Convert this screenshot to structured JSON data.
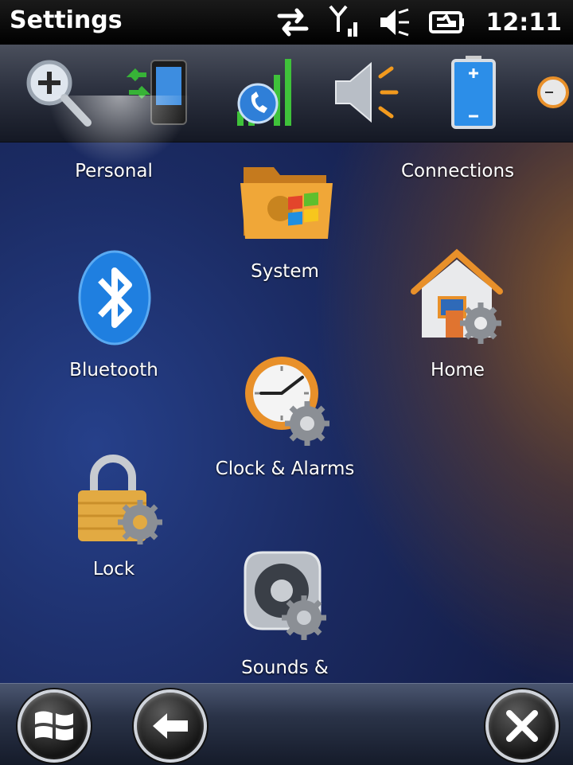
{
  "status_bar": {
    "title": "Settings",
    "time": "12:11",
    "icons": [
      "data-transfer-icon",
      "signal-strength-icon",
      "volume-muted-icon",
      "battery-charging-icon"
    ]
  },
  "tabs": [
    {
      "name": "personal",
      "icon": "magnifier-plus-icon",
      "selected": true
    },
    {
      "name": "sync",
      "icon": "device-sync-icon"
    },
    {
      "name": "phone",
      "icon": "phone-signal-icon"
    },
    {
      "name": "sound",
      "icon": "speaker-icon"
    },
    {
      "name": "power",
      "icon": "battery-icon"
    },
    {
      "name": "clock",
      "icon": "clock-partial-icon"
    }
  ],
  "items": {
    "personal": {
      "label": "Personal"
    },
    "system": {
      "label": "System",
      "icon": "folder-windows-icon"
    },
    "connections": {
      "label": "Connections"
    },
    "bluetooth": {
      "label": "Bluetooth",
      "icon": "bluetooth-icon"
    },
    "home": {
      "label": "Home",
      "icon": "house-gear-icon"
    },
    "clock": {
      "label": "Clock & Alarms",
      "icon": "clock-gear-icon"
    },
    "lock": {
      "label": "Lock",
      "icon": "padlock-gear-icon"
    },
    "sounds": {
      "label": "Sounds &",
      "icon": "speaker-gear-icon"
    }
  },
  "bottom_bar": {
    "start": "windows-logo-icon",
    "back": "back-arrow-icon",
    "close": "close-icon"
  },
  "colors": {
    "accent_orange": "#e8902a",
    "bluetooth_blue": "#1f7fe0",
    "signal_green": "#3fc23a"
  }
}
